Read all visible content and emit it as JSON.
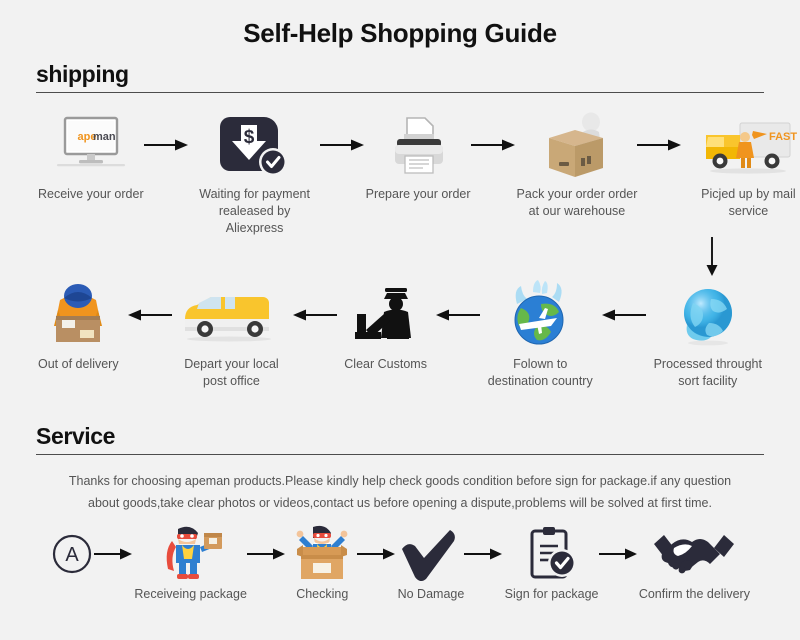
{
  "page": {
    "title": "Self-Help Shopping Guide",
    "background": "#f2f2f2"
  },
  "shipping": {
    "section_title": "shipping",
    "row1": [
      {
        "label": "Receive your order",
        "icon": "monitor-apeman-icon",
        "brand": "apeman"
      },
      {
        "label": "Waiting for payment\nrealeased by Aliexpress",
        "icon": "payment-dollar-check-icon"
      },
      {
        "label": "Prepare your order",
        "icon": "printer-icon"
      },
      {
        "label": "Pack your order order\nat our warehouse",
        "icon": "packing-worker-box-icon"
      },
      {
        "label": "Picjed up by mail service",
        "icon": "fast-delivery-truck-icon",
        "truck_text": "FAST"
      }
    ],
    "row2": [
      {
        "label": "Out of delivery",
        "icon": "courier-carrying-box-icon"
      },
      {
        "label": "Depart your local\npost office",
        "icon": "yellow-delivery-van-icon"
      },
      {
        "label": "Clear Customs",
        "icon": "customs-officer-icon"
      },
      {
        "label": "Folown to\ndestination country",
        "icon": "globe-airplane-icon"
      },
      {
        "label": "Processed throught\nsort facility",
        "icon": "blue-globe-network-icon"
      }
    ],
    "connector": "down-arrow-icon"
  },
  "service": {
    "section_title": "Service",
    "paragraph": "Thanks for choosing apeman products.Please kindly help check goods condition before sign for package.if any question about goods,take clear photos or videos,contact us before opening a dispute,problems will be solved at first time.",
    "steps": [
      {
        "label": "",
        "icon": "circled-a-icon"
      },
      {
        "label": "Receiveing package",
        "icon": "superhero-holding-box-icon"
      },
      {
        "label": "Checking",
        "icon": "superhero-in-box-icon"
      },
      {
        "label": "No Damage",
        "icon": "checkmark-icon"
      },
      {
        "label": "Sign for package",
        "icon": "clipboard-check-icon"
      },
      {
        "label": "Confirm the delivery",
        "icon": "handshake-icon"
      }
    ]
  },
  "colors": {
    "accent_orange": "#f0941e",
    "dark_navy": "#2b2b3a",
    "truck_yellow": "#f9c52d",
    "globe_blue": "#2b7fd4",
    "text_gray": "#555555",
    "rule": "#4d4d4d"
  }
}
